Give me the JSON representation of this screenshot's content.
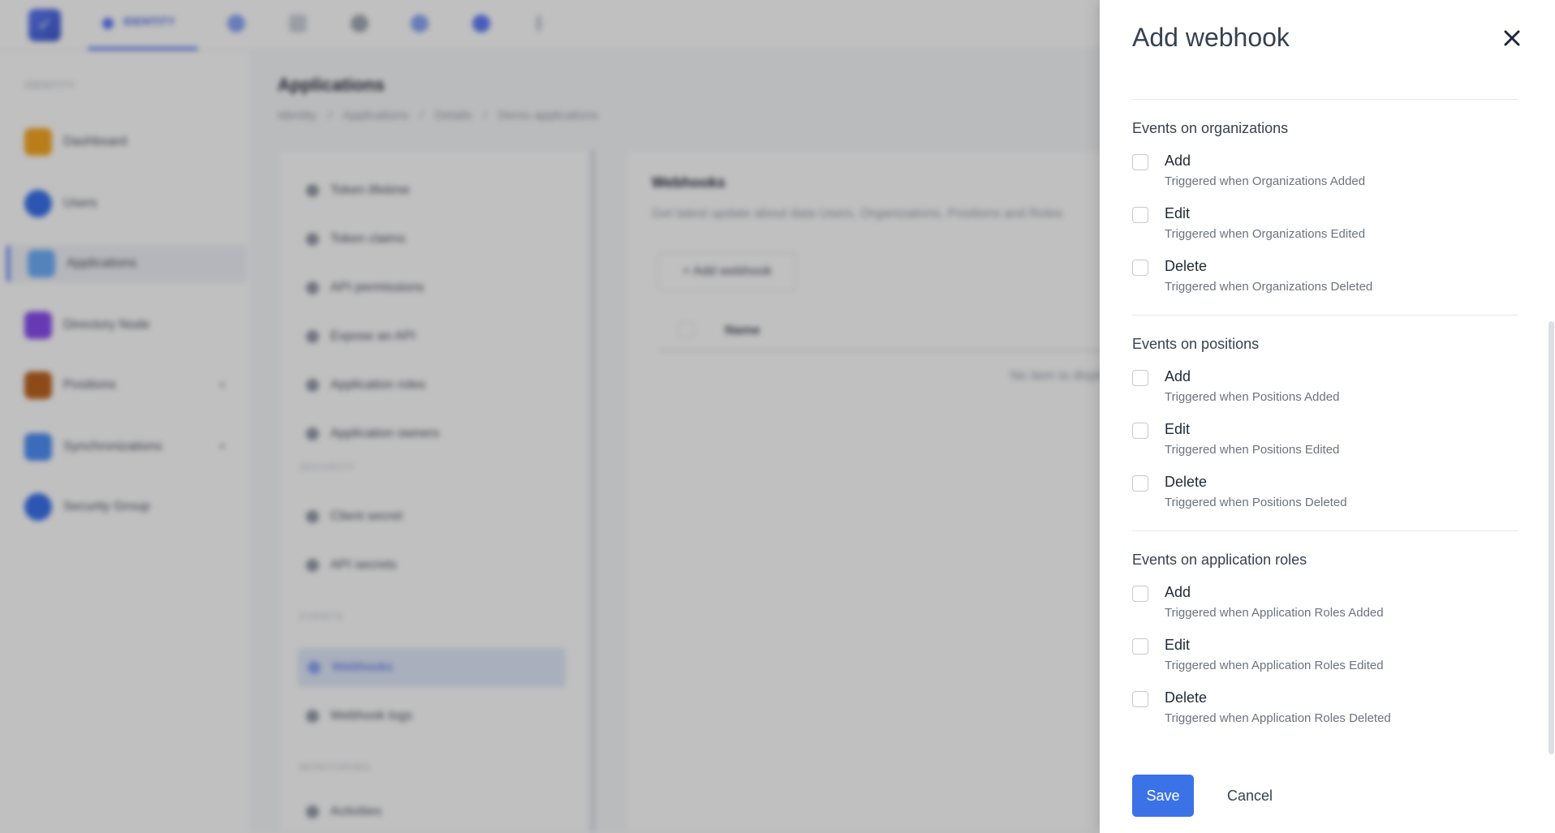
{
  "app": {
    "brand": "IDENTITY",
    "sidebar_section": "IDENTITY",
    "sidebar": [
      {
        "label": "Dashboard",
        "color": "#f59e0b"
      },
      {
        "label": "Users",
        "color": "#2563eb"
      },
      {
        "label": "Applications",
        "color": "#60a5fa"
      },
      {
        "label": "Directory Node",
        "color": "#7c3aed"
      },
      {
        "label": "Positions",
        "color": "#b45309"
      },
      {
        "label": "Synchronizations",
        "color": "#3b82f6"
      },
      {
        "label": "Security Group",
        "color": "#2563eb"
      }
    ],
    "page_title": "Applications",
    "breadcrumb": [
      "Identity",
      "Applications",
      "Details",
      "Demo applications"
    ],
    "subnav": [
      {
        "label": "Token lifetime"
      },
      {
        "label": "Token claims"
      },
      {
        "label": "API permissions"
      },
      {
        "label": "Expose an API"
      },
      {
        "label": "Application roles"
      },
      {
        "label": "Application owners"
      }
    ],
    "subnav_head_1": "SECURITY",
    "subnav_security": [
      {
        "label": "Client secret"
      },
      {
        "label": "API secrets"
      }
    ],
    "subnav_head_2": "EVENTS",
    "subnav_events": [
      {
        "label": "Webhooks"
      },
      {
        "label": "Webhook logs"
      }
    ],
    "subnav_head_3": "MONITORING",
    "subnav_monitoring": [
      {
        "label": "Activities"
      }
    ],
    "content": {
      "title": "Webhooks",
      "subtitle": "Get latest update about data Users, Organizations, Positions and Roles",
      "add_button": "+ Add webhook",
      "col_name": "Name",
      "empty": "No item to display"
    }
  },
  "drawer": {
    "title": "Add webhook",
    "sections": [
      {
        "title": "Events on organizations",
        "options": [
          {
            "label": "Add",
            "desc": "Triggered when Organizations Added",
            "checked": false
          },
          {
            "label": "Edit",
            "desc": "Triggered when Organizations Edited",
            "checked": false
          },
          {
            "label": "Delete",
            "desc": "Triggered when Organizations Deleted",
            "checked": false
          }
        ]
      },
      {
        "title": "Events on positions",
        "options": [
          {
            "label": "Add",
            "desc": "Triggered when Positions Added",
            "checked": false
          },
          {
            "label": "Edit",
            "desc": "Triggered when Positions Edited",
            "checked": false
          },
          {
            "label": "Delete",
            "desc": "Triggered when Positions Deleted",
            "checked": false
          }
        ]
      },
      {
        "title": "Events on application roles",
        "options": [
          {
            "label": "Add",
            "desc": "Triggered when Application Roles Added",
            "checked": false
          },
          {
            "label": "Edit",
            "desc": "Triggered when Application Roles Edited",
            "checked": false
          },
          {
            "label": "Delete",
            "desc": "Triggered when Application Roles Deleted",
            "checked": false
          }
        ]
      }
    ],
    "save_label": "Save",
    "cancel_label": "Cancel"
  },
  "colors": {
    "primary": "#3b72e8",
    "overlay": "rgba(60,60,60,0.32)"
  }
}
